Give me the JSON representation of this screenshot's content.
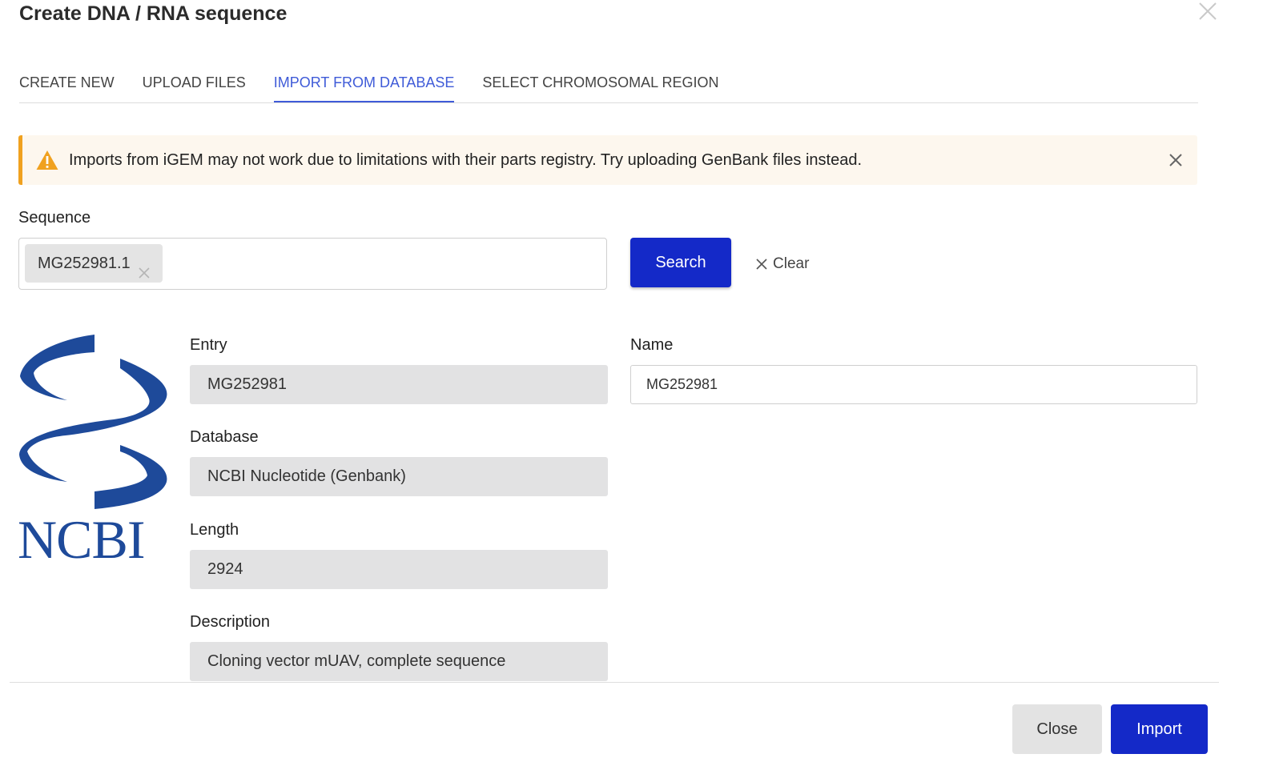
{
  "dialog": {
    "title": "Create DNA / RNA sequence"
  },
  "tabs": [
    {
      "label": "CREATE NEW",
      "active": false
    },
    {
      "label": "UPLOAD FILES",
      "active": false
    },
    {
      "label": "IMPORT FROM DATABASE",
      "active": true
    },
    {
      "label": "SELECT CHROMOSOMAL REGION",
      "active": false
    }
  ],
  "alert": {
    "text": "Imports from iGEM may not work due to limitations with their parts registry. Try uploading GenBank files instead.",
    "icon": "warning-icon",
    "color": "#f0a11f"
  },
  "sequence": {
    "label": "Sequence",
    "chip": "MG252981.1",
    "search_label": "Search",
    "clear_label": "Clear"
  },
  "logo": {
    "text": "NCBI",
    "color": "#1e4a9a"
  },
  "fields": {
    "entry": {
      "label": "Entry",
      "value": "MG252981"
    },
    "database": {
      "label": "Database",
      "value": "NCBI Nucleotide (Genbank)"
    },
    "length": {
      "label": "Length",
      "value": "2924"
    },
    "description": {
      "label": "Description",
      "value": "Cloning vector mUAV, complete sequence"
    },
    "name": {
      "label": "Name",
      "value": "MG252981"
    }
  },
  "footer": {
    "close_label": "Close",
    "import_label": "Import"
  },
  "colors": {
    "primary": "#1429c8",
    "tab_active": "#3f5bd8"
  }
}
